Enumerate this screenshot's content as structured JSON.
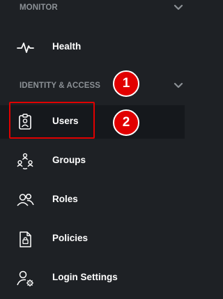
{
  "sections": {
    "monitor": {
      "title": "MONITOR"
    },
    "identity": {
      "title": "IDENTITY & ACCESS"
    }
  },
  "items": {
    "health": {
      "label": "Health",
      "icon": "pulse-icon"
    },
    "users": {
      "label": "Users",
      "icon": "user-badge-icon",
      "active": true
    },
    "groups": {
      "label": "Groups",
      "icon": "group-icon"
    },
    "roles": {
      "label": "Roles",
      "icon": "roles-icon"
    },
    "policies": {
      "label": "Policies",
      "icon": "document-lock-icon"
    },
    "login_settings": {
      "label": "Login Settings",
      "icon": "user-gear-icon"
    }
  },
  "annotations": {
    "badge1": "1",
    "badge2": "2"
  },
  "colors": {
    "background": "#1e2125",
    "active_background": "#15181c",
    "section_text": "#8c9196",
    "item_text": "#ffffff",
    "highlight": "#e00000"
  }
}
